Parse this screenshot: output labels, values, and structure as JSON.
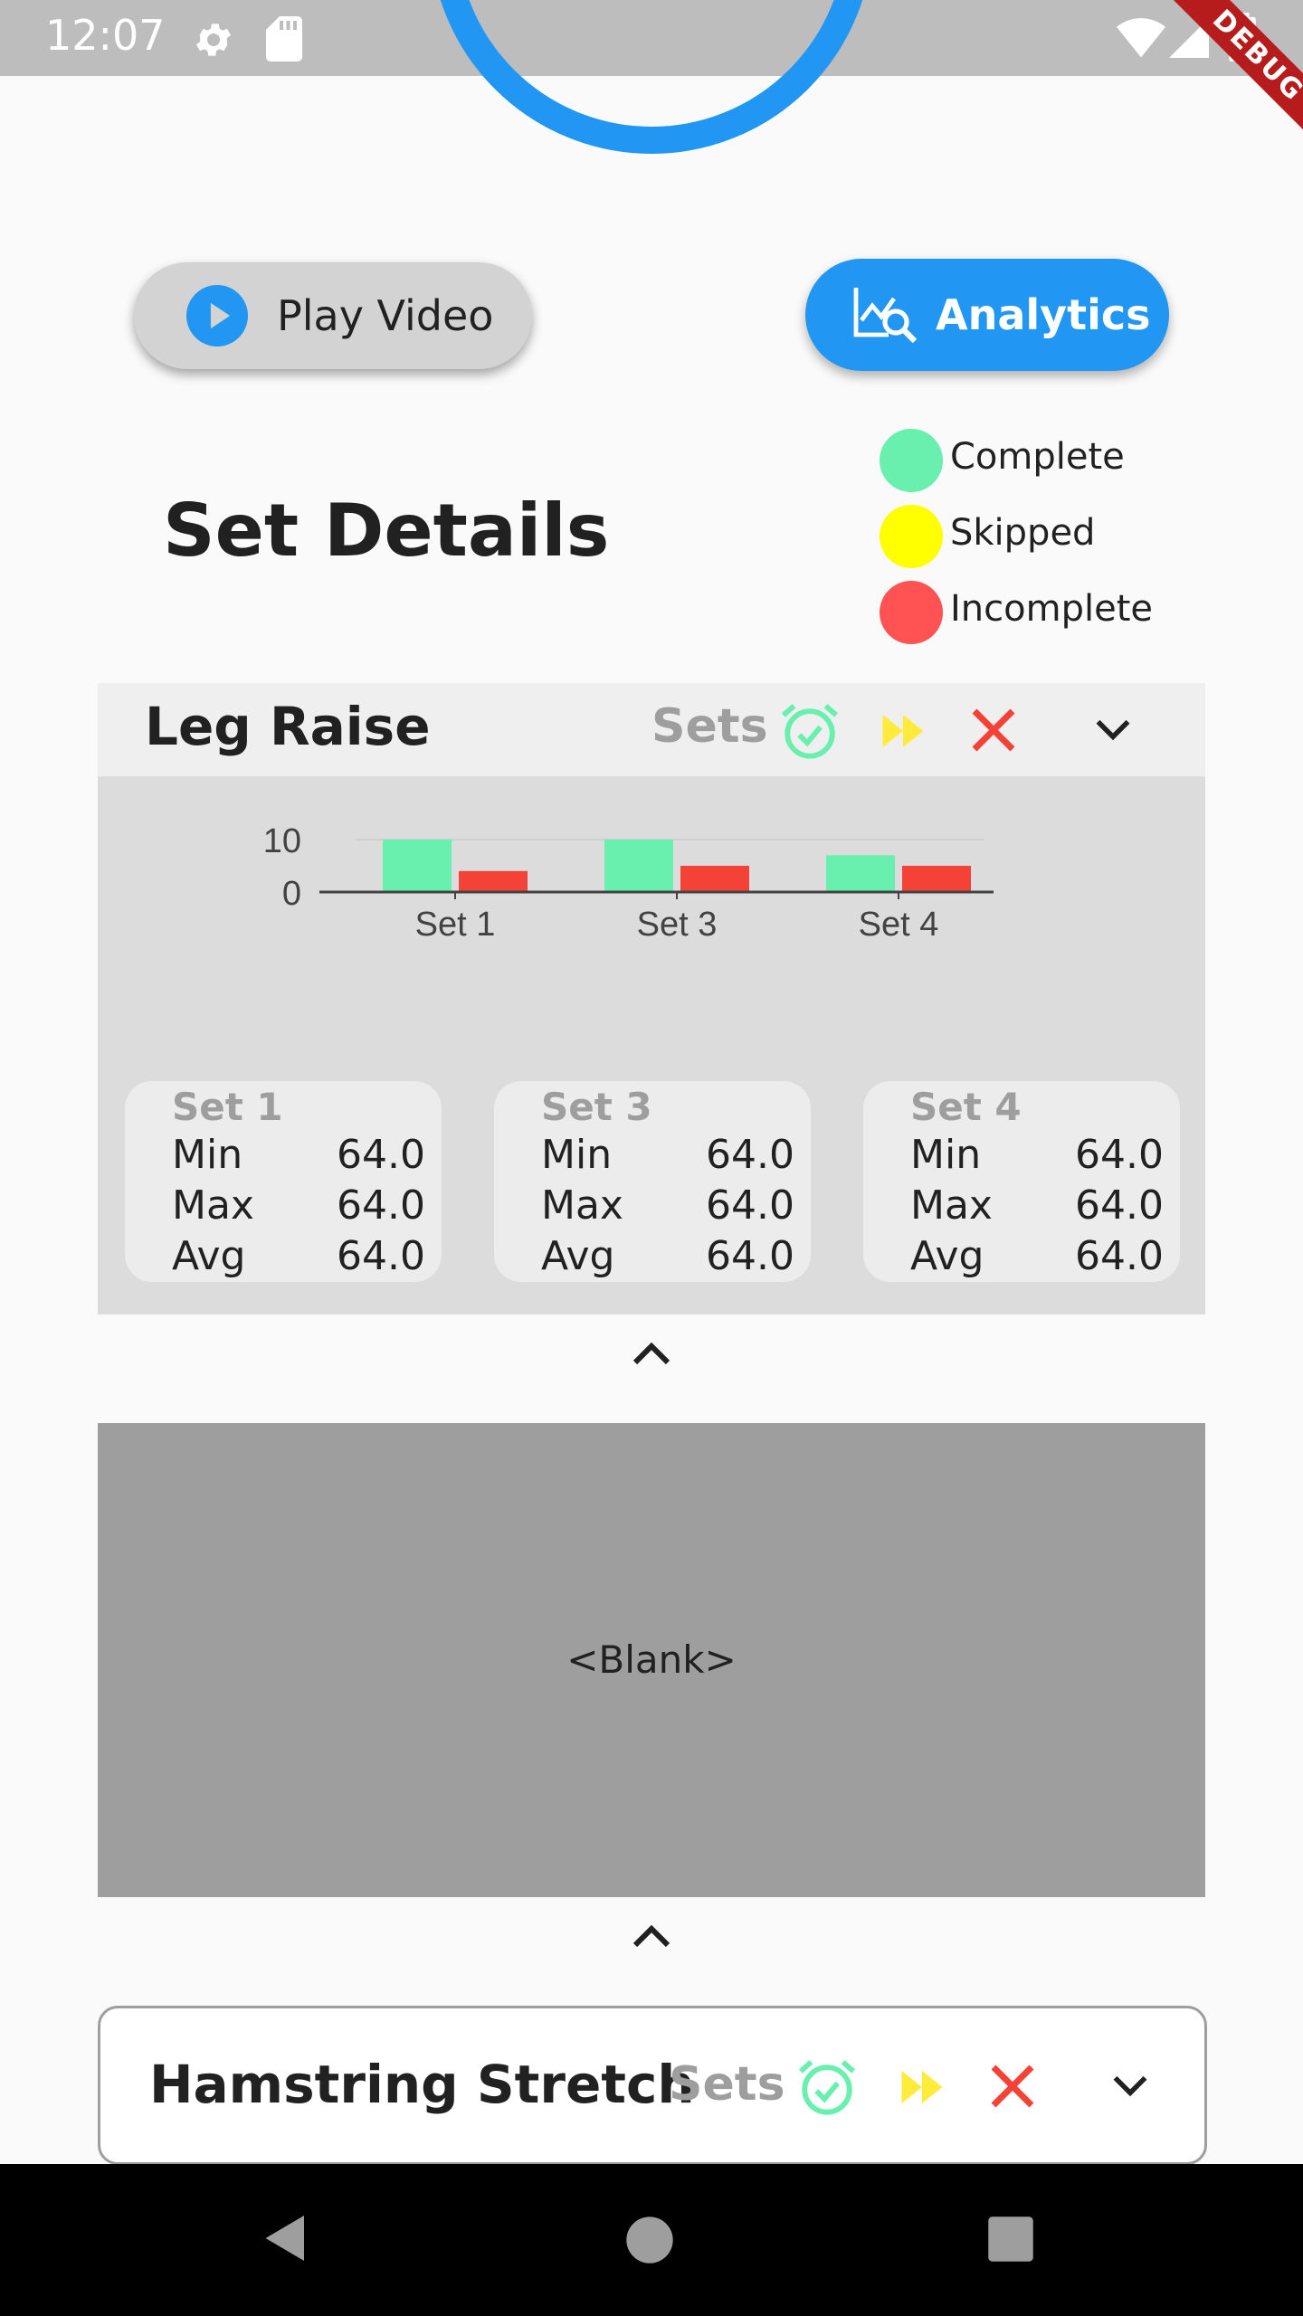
{
  "status_bar": {
    "time": "12:07"
  },
  "debug_banner": "DEBUG",
  "buttons": {
    "play_video": "Play Video",
    "analytics": "Analytics"
  },
  "page_title": "Set Details",
  "legend": [
    {
      "label": "Complete",
      "color": "#69f0ae"
    },
    {
      "label": "Skipped",
      "color": "#ffff00"
    },
    {
      "label": "Incomplete",
      "color": "#ff5252"
    }
  ],
  "exercises": [
    {
      "title": "Leg Raise",
      "sets_label": "Sets"
    },
    {
      "title": "Hamstring Stretch",
      "sets_label": "Sets"
    }
  ],
  "chart_data": {
    "type": "bar",
    "categories": [
      "Set 1",
      "Set 3",
      "Set 4"
    ],
    "series": [
      {
        "values": [
          10,
          10,
          7
        ],
        "color": "#69f0ae"
      },
      {
        "values": [
          4,
          5,
          5
        ],
        "color": "#f44336"
      }
    ],
    "y_ticks": [
      "0",
      "10"
    ],
    "ylim": [
      0,
      10
    ],
    "grid": true
  },
  "set_stats": [
    {
      "name": "Set 1",
      "min_label": "Min",
      "min": "64.0",
      "max_label": "Max",
      "max": "64.0",
      "avg_label": "Avg",
      "avg": "64.0"
    },
    {
      "name": "Set 3",
      "min_label": "Min",
      "min": "64.0",
      "max_label": "Max",
      "max": "64.0",
      "avg_label": "Avg",
      "avg": "64.0"
    },
    {
      "name": "Set 4",
      "min_label": "Min",
      "min": "64.0",
      "max_label": "Max",
      "max": "64.0",
      "avg_label": "Avg",
      "avg": "64.0"
    }
  ],
  "blank_panel": "<Blank>",
  "colors": {
    "accent": "#2196f3",
    "complete": "#69f0ae",
    "skipped": "#ffeb3b",
    "incomplete": "#f44336"
  }
}
